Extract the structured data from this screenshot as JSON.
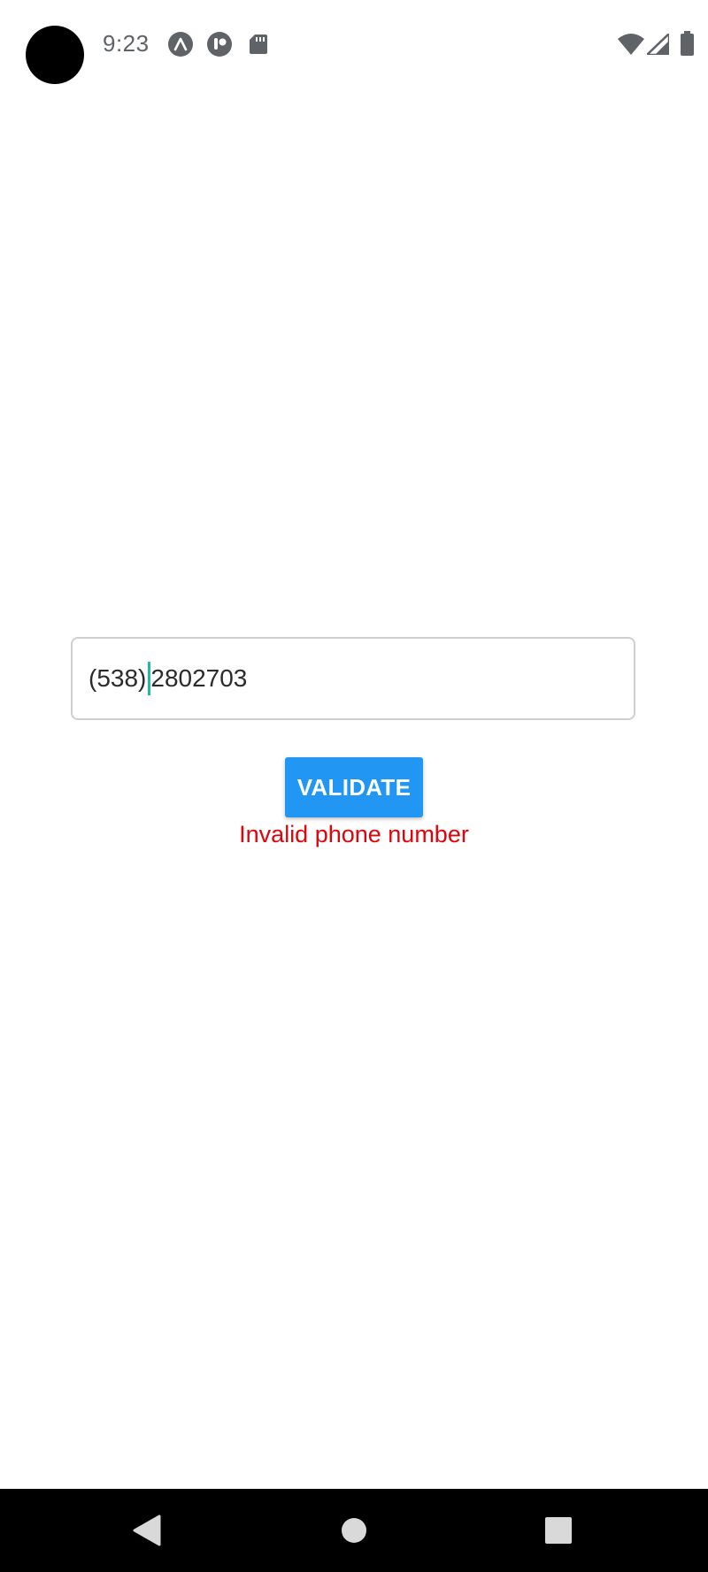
{
  "status_bar": {
    "time": "9:23",
    "notification_icons": [
      "expo-go-icon",
      "app-notification-icon",
      "sd-card-icon"
    ],
    "system_icons": [
      "wifi-icon",
      "signal-icon",
      "battery-icon"
    ]
  },
  "form": {
    "phone_value_before_caret": "(538)",
    "phone_value_after_caret": "2802703",
    "validate_label": "VALIDATE",
    "error_message": "Invalid phone number"
  },
  "colors": {
    "accent": "#2196f3",
    "error": "#e0040b",
    "caret": "#1bbf9f"
  },
  "nav_bar": {
    "buttons": [
      "back",
      "home",
      "recents"
    ]
  }
}
